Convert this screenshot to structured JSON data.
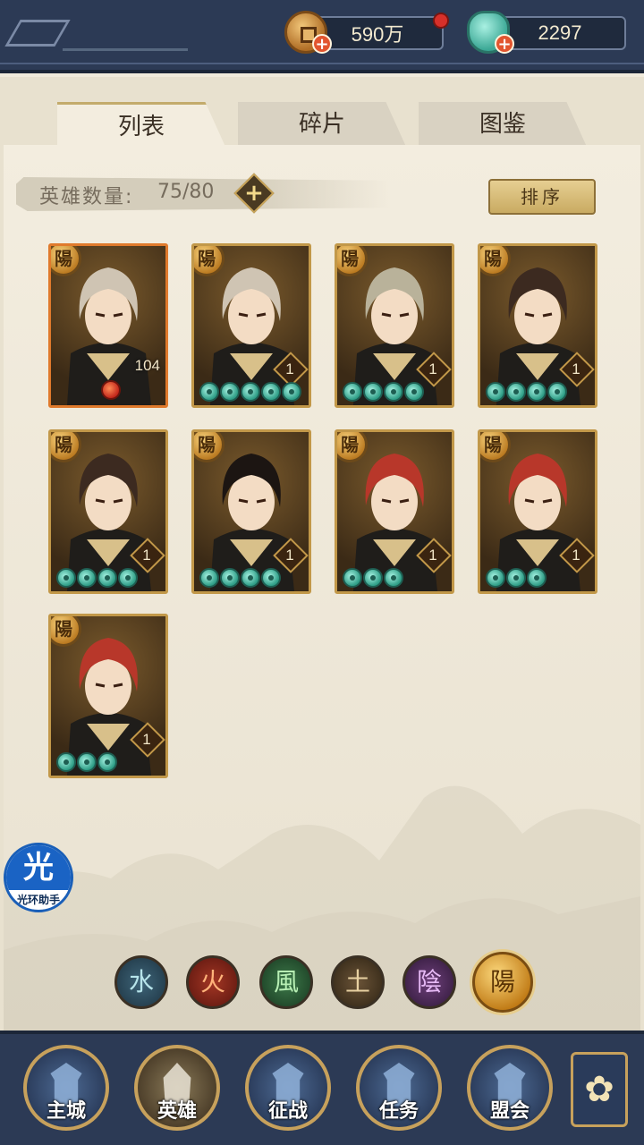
{
  "currencies": {
    "copper": "590万",
    "jade": "2297"
  },
  "tabs": {
    "list": "列表",
    "shards": "碎片",
    "atlas": "图鉴"
  },
  "hero_count": {
    "label": "英雄数量:",
    "value": "75/80"
  },
  "sort_button": "排序",
  "heroes": [
    {
      "level": "104",
      "stars": 0,
      "faction": "陽",
      "highlight": true
    },
    {
      "level": "1",
      "stars": 5,
      "faction": "陽"
    },
    {
      "level": "1",
      "stars": 4,
      "faction": "陽"
    },
    {
      "level": "1",
      "stars": 4,
      "faction": "陽"
    },
    {
      "level": "1",
      "stars": 4,
      "faction": "陽"
    },
    {
      "level": "1",
      "stars": 4,
      "faction": "陽"
    },
    {
      "level": "1",
      "stars": 3,
      "faction": "陽"
    },
    {
      "level": "1",
      "stars": 3,
      "faction": "陽"
    },
    {
      "level": "1",
      "stars": 3,
      "faction": "陽"
    }
  ],
  "elements": [
    "水",
    "火",
    "風",
    "土",
    "陰",
    "陽"
  ],
  "helper": {
    "glyph": "光",
    "name": "光环助手"
  },
  "nav": {
    "city": "主城",
    "hero": "英雄",
    "battle": "征战",
    "task": "任务",
    "guild": "盟会"
  },
  "colors": {
    "topbar": "#2c3a55",
    "panel": "#f3eddf",
    "gold_border": "#c29849"
  }
}
